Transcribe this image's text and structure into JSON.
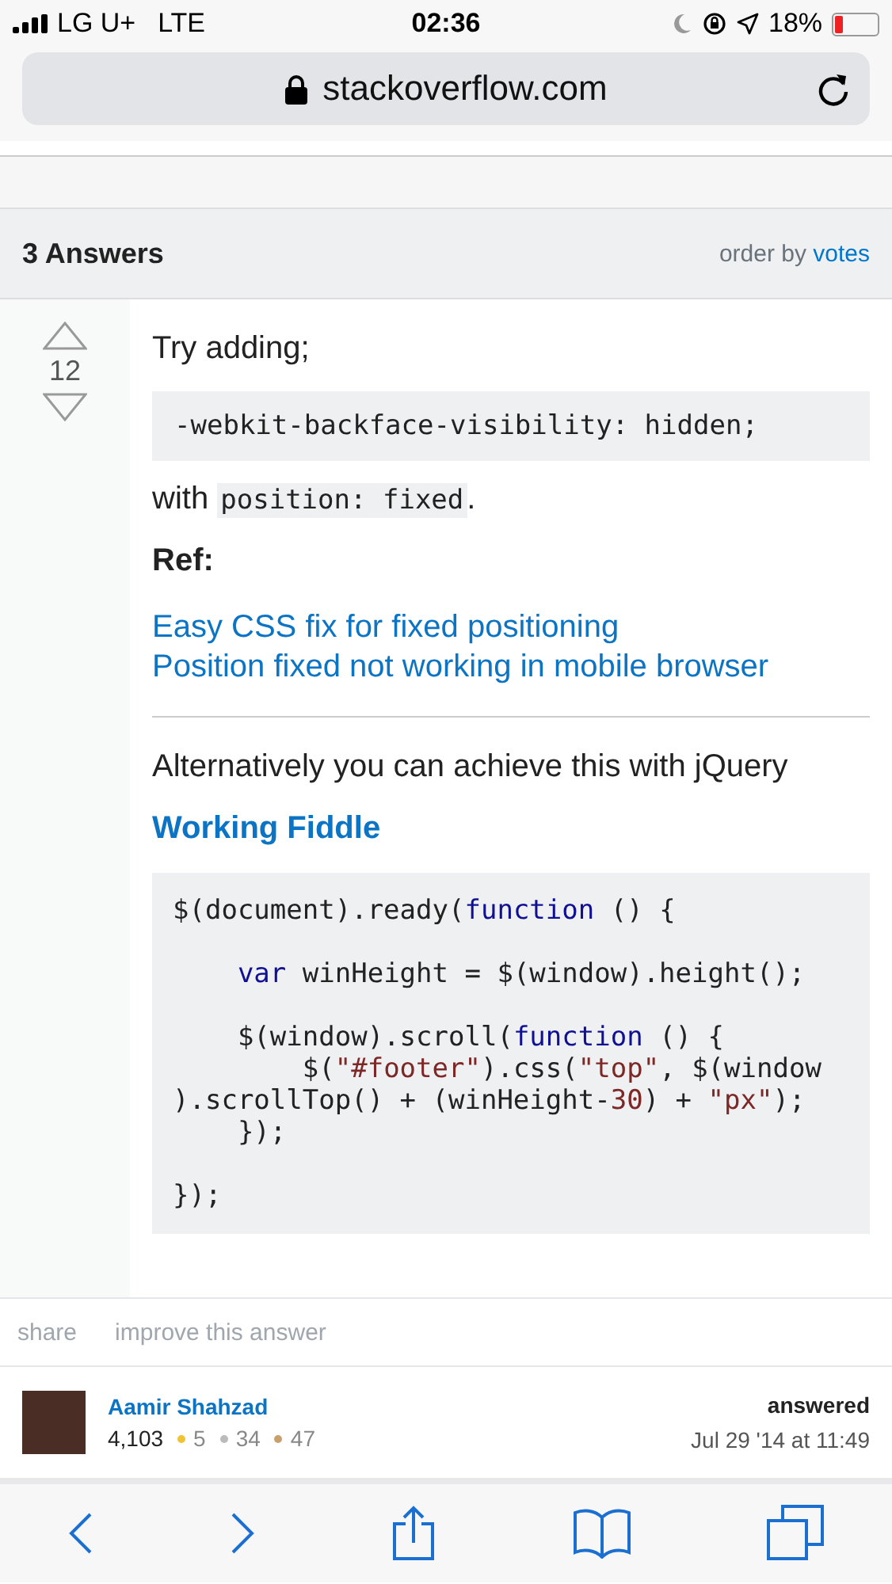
{
  "status_bar": {
    "carrier": "LG U+",
    "network": "LTE",
    "time": "02:36",
    "battery": "18%"
  },
  "address_bar": {
    "url": "stackoverflow.com"
  },
  "answers_header": {
    "title": "3 Answers",
    "order_label": "order by",
    "order_link": "votes"
  },
  "answer": {
    "votes": "12",
    "intro": "Try adding;",
    "code_1": "-webkit-backface-visibility: hidden;",
    "with_text": "with ",
    "inline_code": "position: fixed",
    "with_end": ".",
    "ref_label": "Ref:",
    "ref_links": [
      "Easy CSS fix for fixed positioning",
      "Position fixed not working in mobile browser"
    ],
    "alternative": "Alternatively you can achieve this with jQuery",
    "fiddle_link": "Working Fiddle",
    "code_2": [
      [
        [
          {
            "kind": "plain",
            "text": "$(document).ready("
          },
          {
            "kind": "keyword",
            "text": "function"
          },
          {
            "kind": "plain",
            "text": " () {"
          }
        ]
      ],
      [
        [
          {
            "kind": "keyword",
            "text": "    var"
          },
          {
            "kind": "plain",
            "text": " winHeight = $(window).height();"
          }
        ]
      ],
      [
        [
          {
            "kind": "plain",
            "text": "    $(window).scroll("
          },
          {
            "kind": "keyword",
            "text": "function"
          },
          {
            "kind": "plain",
            "text": " () {"
          }
        ],
        [
          {
            "kind": "plain",
            "text": "        $("
          },
          {
            "kind": "string",
            "text": "\"#footer\""
          },
          {
            "kind": "plain",
            "text": ").css("
          },
          {
            "kind": "string",
            "text": "\"top\""
          },
          {
            "kind": "plain",
            "text": ", $(window"
          }
        ],
        [
          {
            "kind": "plain",
            "text": ").scrollTop() + (winHeight-"
          },
          {
            "kind": "number",
            "text": "30"
          },
          {
            "kind": "plain",
            "text": ") + "
          },
          {
            "kind": "string",
            "text": "\"px\""
          },
          {
            "kind": "plain",
            "text": ");"
          }
        ],
        [
          {
            "kind": "plain",
            "text": "    });"
          }
        ]
      ],
      [
        [
          {
            "kind": "plain",
            "text": "});"
          }
        ]
      ]
    ],
    "actions": [
      "share",
      "improve this answer"
    ],
    "user": {
      "name": "Aamir Shahzad",
      "reputation": "4,103",
      "badges": [
        {
          "count": "5",
          "color": "#f1c232"
        },
        {
          "count": "34",
          "color": "#bbbbbb"
        },
        {
          "count": "47",
          "color": "#c8a06e"
        }
      ]
    },
    "answered_label": "answered",
    "answered_date": "Jul 29 '14 at 11:49"
  }
}
